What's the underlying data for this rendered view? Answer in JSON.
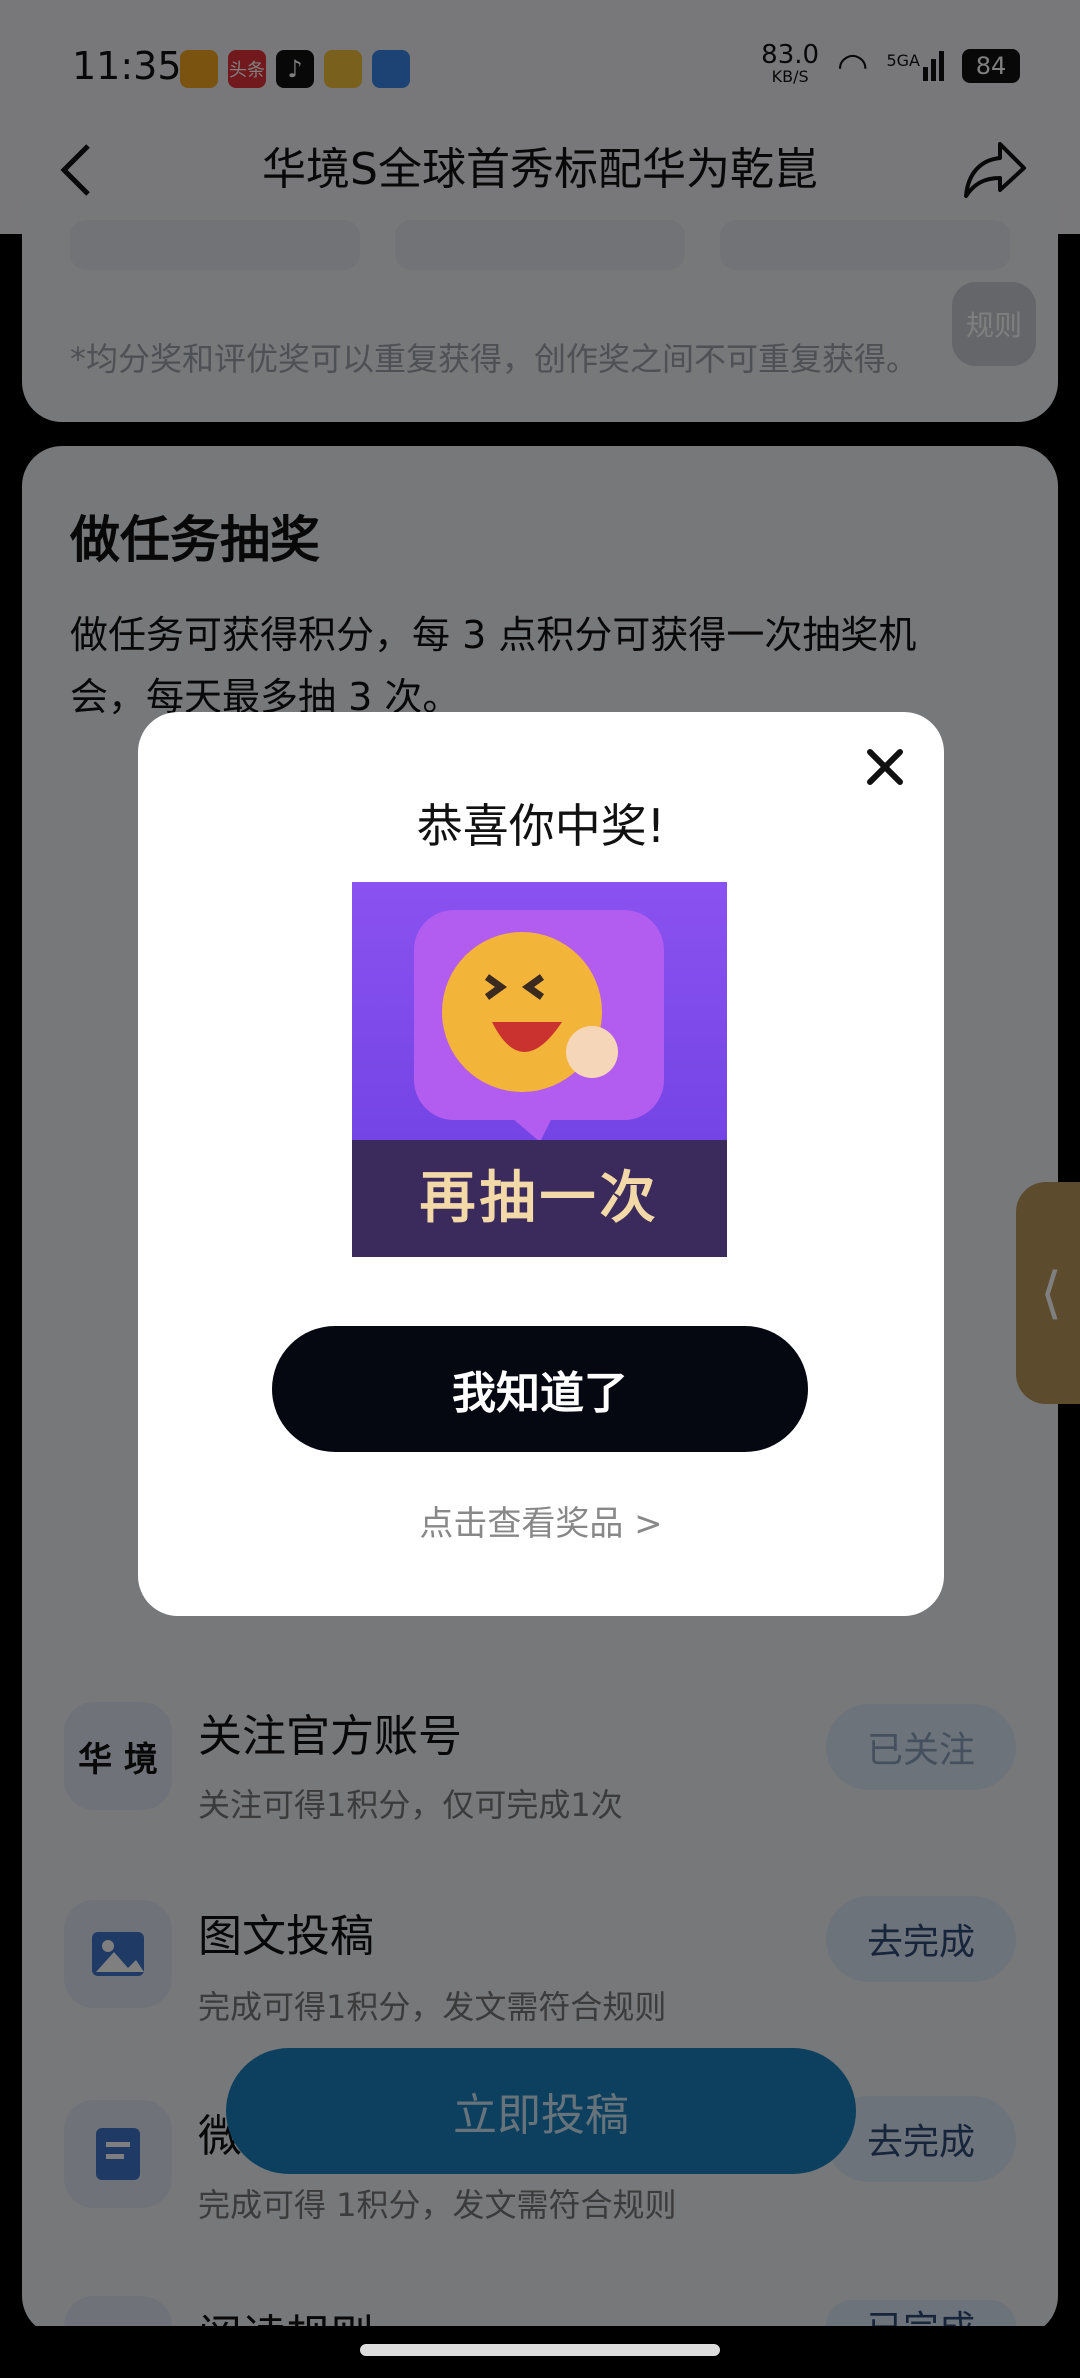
{
  "status_bar": {
    "time": "11:35",
    "network_speed_value": "83.0",
    "network_speed_unit": "KB/S",
    "signal_label": "5GA",
    "battery": "84",
    "app_icons": [
      "pinduoduo-icon",
      "toutiao-icon",
      "tiktok-icon",
      "weibo-icon",
      "meetfaw-icon"
    ],
    "toutiao_label": "头条"
  },
  "nav": {
    "title": "华境S全球首秀标配华为乾崑",
    "back_icon": "chevron-left-icon",
    "share_icon": "share-icon"
  },
  "rules_card": {
    "note": "*均分奖和评优奖可以重复获得，创作奖之间不可重复获得。",
    "rules_button": "规则"
  },
  "task_section": {
    "title": "做任务抽奖",
    "description": "做任务可获得积分，每 3 点积分可获得一次抽奖机会，每天最多抽 3 次。",
    "tasks": [
      {
        "icon": "brand-logo-icon",
        "icon_text": "华 境",
        "title": "关注官方账号",
        "desc": "关注可得1积分，仅可完成1次",
        "button": "已关注"
      },
      {
        "icon": "image-icon",
        "title": "图文投稿",
        "desc": "完成可得1积分，发文需符合规则",
        "button": "去完成"
      },
      {
        "icon": "document-icon",
        "title": "微",
        "desc": "完成可得 1积分，发文需符合规则",
        "button": "去完成"
      },
      {
        "icon": "book-icon",
        "title": "阅读规则",
        "desc": "",
        "button": "已完成"
      }
    ]
  },
  "submit_button": "立即投稿",
  "dialog": {
    "title": "恭喜你中奖!",
    "prize_label": "再抽一次",
    "confirm_button": "我知道了",
    "view_prizes_link": "点击查看奖品 >"
  },
  "colors": {
    "dialog_button": "#050810",
    "prize_gradient_top": "#8a52f0",
    "side_tab": "#b9965a",
    "submit_button": "#1a7fbf"
  }
}
